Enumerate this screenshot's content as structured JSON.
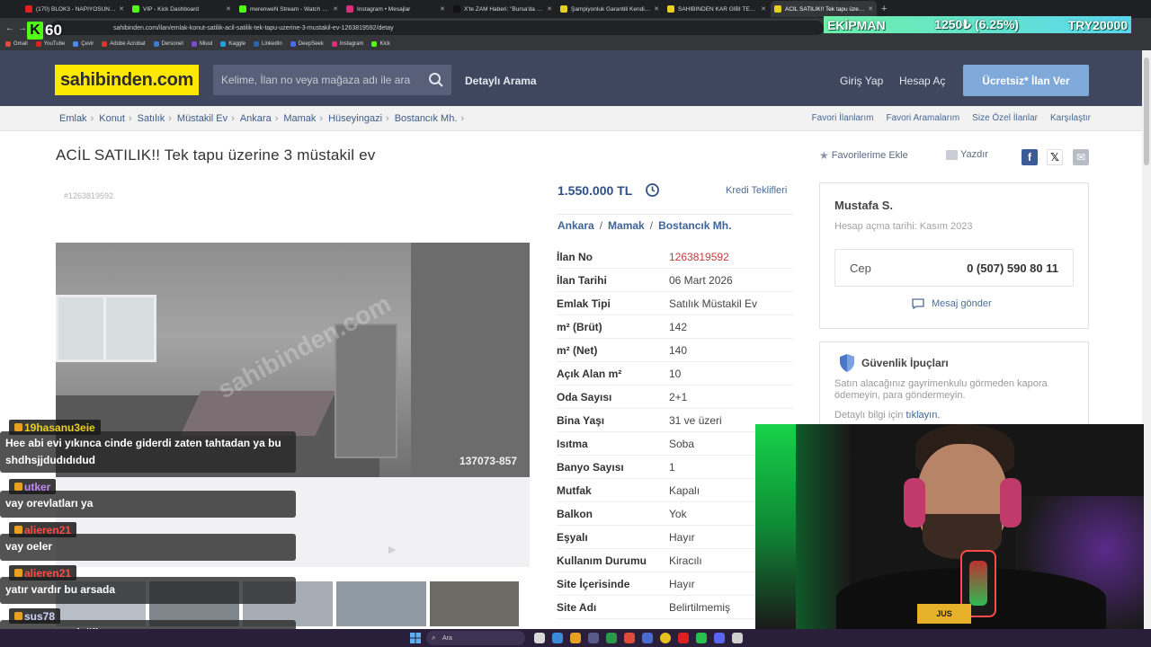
{
  "browser": {
    "tabs": [
      {
        "label": "(170) BLOK3 - NAPIYOSUN MI...",
        "color": "#e02020",
        "active": false
      },
      {
        "label": "VIP - Kick Dashboard",
        "color": "#53fc18",
        "active": false
      },
      {
        "label": "merenweN Stream - Watch Live",
        "color": "#53fc18",
        "active": false
      },
      {
        "label": "Instagram • Mesajlar",
        "color": "#d6307a",
        "active": false
      },
      {
        "label": "X'te ZAM Haberi: \"Bursa'da bir...",
        "color": "#111111",
        "active": false
      },
      {
        "label": "Şampiyonluk Garantili Kendini...",
        "color": "#e8d020",
        "active": false
      },
      {
        "label": "SAHİBİNDEN KAR GİBİ TEMİZ ...",
        "color": "#e8d020",
        "active": false
      },
      {
        "label": "ACİL SATILIK!! Tek tapu üzerine...",
        "color": "#e8d020",
        "active": true
      }
    ],
    "url": "sahibinden.com/ilan/emlak-konut-satilik-acil-satilik-tek-tapu-uzerine-3-mustakil-ev-1263819592/detay",
    "bookmarks": [
      {
        "label": "Gmail",
        "color": "#e04a3a"
      },
      {
        "label": "YouTube",
        "color": "#e02020"
      },
      {
        "label": "Çevir",
        "color": "#4a8af0"
      },
      {
        "label": "Adobe Acrobat",
        "color": "#d83a2a"
      },
      {
        "label": "Dersonet",
        "color": "#3a7ad0"
      },
      {
        "label": "Miuul",
        "color": "#7a4ad0"
      },
      {
        "label": "Kaggle",
        "color": "#20a0e0"
      },
      {
        "label": "LinkedIn",
        "color": "#2a66b0"
      },
      {
        "label": "DeepSeek",
        "color": "#4a6af0"
      },
      {
        "label": "Instagram",
        "color": "#d6307a"
      },
      {
        "label": "Kick",
        "color": "#53fc18"
      }
    ]
  },
  "overlay": {
    "kick_count": "60",
    "ticker_name": "EKİPMAN",
    "ticker_change": "1250₺ (6.25%)",
    "ticker_total": "TRY20000"
  },
  "site": {
    "logo": "sahibinden.com",
    "search_placeholder": "Kelime, İlan no veya mağaza adı ile ara",
    "detayli": "Detaylı Arama",
    "login": "Giriş Yap",
    "register": "Hesap Aç",
    "post_ad": "Ücretsiz* İlan Ver",
    "crumbs": [
      "Emlak",
      "Konut",
      "Satılık",
      "Müstakil Ev",
      "Ankara",
      "Mamak",
      "Hüseyingazi",
      "Bostancık Mh."
    ],
    "toplinks": [
      "Favori İlanlarım",
      "Favori Aramalarım",
      "Size Özel İlanlar",
      "Karşılaştır"
    ]
  },
  "listing": {
    "title": "ACİL SATILIK!! Tek tapu üzerine 3 müstakil ev",
    "fav": "Favorilerime Ekle",
    "print": "Yazdır",
    "id": "#1263819592",
    "photo_code": "137073-857",
    "price": "1.550.000 TL",
    "kredi": "Kredi Teklifleri",
    "location": [
      "Ankara",
      "Mamak",
      "Bostancık Mh."
    ],
    "attributes": [
      {
        "k": "İlan No",
        "v": "1263819592",
        "red": true
      },
      {
        "k": "İlan Tarihi",
        "v": "06 Mart 2026"
      },
      {
        "k": "Emlak Tipi",
        "v": "Satılık Müstakil Ev"
      },
      {
        "k": "m² (Brüt)",
        "v": "142"
      },
      {
        "k": "m² (Net)",
        "v": "140"
      },
      {
        "k": "Açık Alan m²",
        "v": "10"
      },
      {
        "k": "Oda Sayısı",
        "v": "2+1"
      },
      {
        "k": "Bina Yaşı",
        "v": "31 ve üzeri"
      },
      {
        "k": "Isıtma",
        "v": "Soba"
      },
      {
        "k": "Banyo Sayısı",
        "v": "1"
      },
      {
        "k": "Mutfak",
        "v": "Kapalı"
      },
      {
        "k": "Balkon",
        "v": "Yok"
      },
      {
        "k": "Eşyalı",
        "v": "Hayır"
      },
      {
        "k": "Kullanım Durumu",
        "v": "Kiracılı"
      },
      {
        "k": "Site İçerisinde",
        "v": "Hayır"
      },
      {
        "k": "Site Adı",
        "v": "Belirtilmemiş"
      }
    ]
  },
  "seller": {
    "name": "Mustafa S.",
    "since": "Hesap açma tarihi: Kasım 2023",
    "phone_label": "Cep",
    "phone": "0 (507) 590 80 11",
    "message": "Mesaj gönder"
  },
  "safety": {
    "title": "Güvenlik İpuçları",
    "desc": "Satın alacağınız gayrimenkulu görmeden kapora ödemeyin, para göndermeyin.",
    "more_prefix": "Detaylı bilgi için",
    "more_link": "tıklayın."
  },
  "chat": [
    {
      "user": "19hasanu3eie",
      "color": "#e8d020",
      "text": "Hee abi evi yıkınca cinde giderdi zaten tahtadan ya bu shdhsjjdudıdıdud"
    },
    {
      "user": "utker",
      "color": "#c08af0",
      "text": "vay orevlatları ya"
    },
    {
      "user": "alieren21",
      "color": "#ff4a4a",
      "text": "vay oeler"
    },
    {
      "user": "alieren21",
      "color": "#ff4a4a",
      "text": "yatır vardır bu arsada"
    },
    {
      "user": "sus78",
      "color": "#d0d0ff",
      "text": "sorun parası değil"
    }
  ],
  "cam": {
    "shirt": "JUS"
  },
  "taskbar": {
    "search": "Ara"
  }
}
